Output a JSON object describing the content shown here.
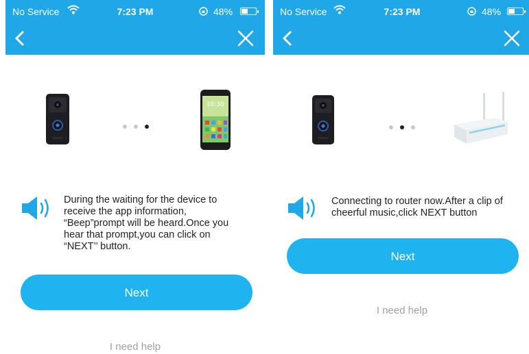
{
  "status_bar": {
    "carrier": "No Service",
    "time": "7:23 PM",
    "battery": "48%",
    "battery_level": 0.48
  },
  "icons": {
    "back": "chevron-left-icon",
    "close": "close-icon",
    "wifi": "wifi-icon",
    "lock": "rotation-lock-icon",
    "speaker": "speaker-icon"
  },
  "colors": {
    "header": "#1fa7e8",
    "button": "#1fb3f0",
    "help_text": "#a0a0a0",
    "dot_active": "#222222",
    "dot_inactive": "#c8c8c8"
  },
  "screens": [
    {
      "instruction": "During the waiting for the device to\nreceive the app information,\n“Beep”prompt will be heard.Once you\nhear that prompt,you can click on\n“NEXT’’ button.",
      "next_label": "Next",
      "help_label": "I need help",
      "active_step": 3,
      "total_steps": 3
    },
    {
      "instruction": "Connecting to router now.After a clip of\ncheerful music,click NEXT button",
      "next_label": "Next",
      "help_label": "I need help",
      "active_step": 2,
      "total_steps": 3
    }
  ]
}
